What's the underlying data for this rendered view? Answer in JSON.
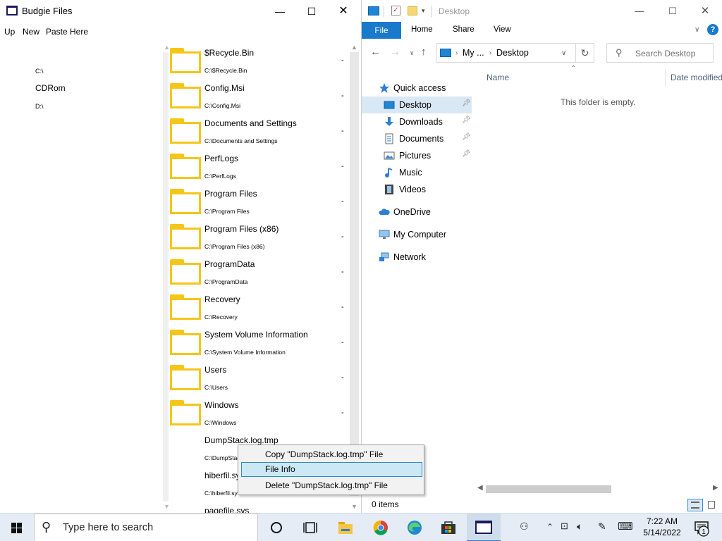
{
  "budgie": {
    "title": "Budgie Files",
    "menu": [
      "Up",
      "New",
      "Paste Here"
    ],
    "drives": [
      {
        "label": "C:\\",
        "size": "small"
      },
      {
        "label": "CDRom",
        "size": "big"
      },
      {
        "label": "D:\\",
        "size": "small"
      }
    ],
    "rows": [
      {
        "name": "$Recycle.Bin",
        "path": "C:\\$Recycle.Bin",
        "type": "folder"
      },
      {
        "name": "Config.Msi",
        "path": "C:\\Config.Msi",
        "type": "folder"
      },
      {
        "name": "Documents and Settings",
        "path": "C:\\Documents and Settings",
        "type": "folder"
      },
      {
        "name": "PerfLogs",
        "path": "C:\\PerfLogs",
        "type": "folder"
      },
      {
        "name": "Program Files",
        "path": "C:\\Program Files",
        "type": "folder"
      },
      {
        "name": "Program Files (x86)",
        "path": "C:\\Program Files (x86)",
        "type": "folder"
      },
      {
        "name": "ProgramData",
        "path": "C:\\ProgramData",
        "type": "folder"
      },
      {
        "name": "Recovery",
        "path": "C:\\Recovery",
        "type": "folder"
      },
      {
        "name": "System Volume Information",
        "path": "C:\\System Volume Information",
        "type": "folder"
      },
      {
        "name": "Users",
        "path": "C:\\Users",
        "type": "folder"
      },
      {
        "name": "Windows",
        "path": "C:\\Windows",
        "type": "folder"
      },
      {
        "name": "DumpStack.log.tmp",
        "path": "C:\\DumpStack.log.tmp",
        "type": "file"
      },
      {
        "name": "hiberfil.sys",
        "path": "C:\\hiberfil.sys",
        "type": "file"
      },
      {
        "name": "pagefile.sys",
        "path": "",
        "type": "file"
      }
    ],
    "row_action_label": "-"
  },
  "context_menu": {
    "items": [
      {
        "label": "Copy \"DumpStack.log.tmp\" File",
        "highlighted": false
      },
      {
        "label": "File Info",
        "highlighted": true
      },
      {
        "label": "Delete \"DumpStack.log.tmp\" File",
        "highlighted": false
      }
    ]
  },
  "explorer": {
    "title": "Desktop",
    "ribbon_tabs": [
      "File",
      "Home",
      "Share",
      "View"
    ],
    "address": {
      "part1": "My ...",
      "sep": ">",
      "part2": "Desktop"
    },
    "search_placeholder": "Search Desktop",
    "nav": [
      {
        "label": "Quick access",
        "icon": "star-icon",
        "pinned": false,
        "selected": false
      },
      {
        "label": "Desktop",
        "icon": "desktop-folder-icon",
        "pinned": true,
        "selected": true
      },
      {
        "label": "Downloads",
        "icon": "download-arrow-icon",
        "pinned": true,
        "selected": false
      },
      {
        "label": "Documents",
        "icon": "documents-icon",
        "pinned": true,
        "selected": false
      },
      {
        "label": "Pictures",
        "icon": "pictures-icon",
        "pinned": true,
        "selected": false
      },
      {
        "label": "Music",
        "icon": "music-note-icon",
        "pinned": false,
        "selected": false
      },
      {
        "label": "Videos",
        "icon": "film-icon",
        "pinned": false,
        "selected": false
      },
      {
        "label": "OneDrive",
        "icon": "cloud-icon",
        "pinned": false,
        "selected": false
      },
      {
        "label": "My Computer",
        "icon": "monitor-icon",
        "pinned": false,
        "selected": false
      },
      {
        "label": "Network",
        "icon": "network-icon",
        "pinned": false,
        "selected": false
      }
    ],
    "columns": [
      "Name",
      "Date modified"
    ],
    "empty_message": "This folder is empty.",
    "status": "0 items"
  },
  "taskbar": {
    "search_placeholder": "Type here to search",
    "time": "7:22 AM",
    "date": "5/14/2022",
    "notification_count": "1"
  },
  "colors": {
    "folder_yellow": "#f5c518",
    "file_tab_blue": "#1979ca",
    "nav_selected": "#d9e8f5",
    "menu_highlight": "#cce8f4",
    "taskbar_bg": "#e5ecf5"
  }
}
